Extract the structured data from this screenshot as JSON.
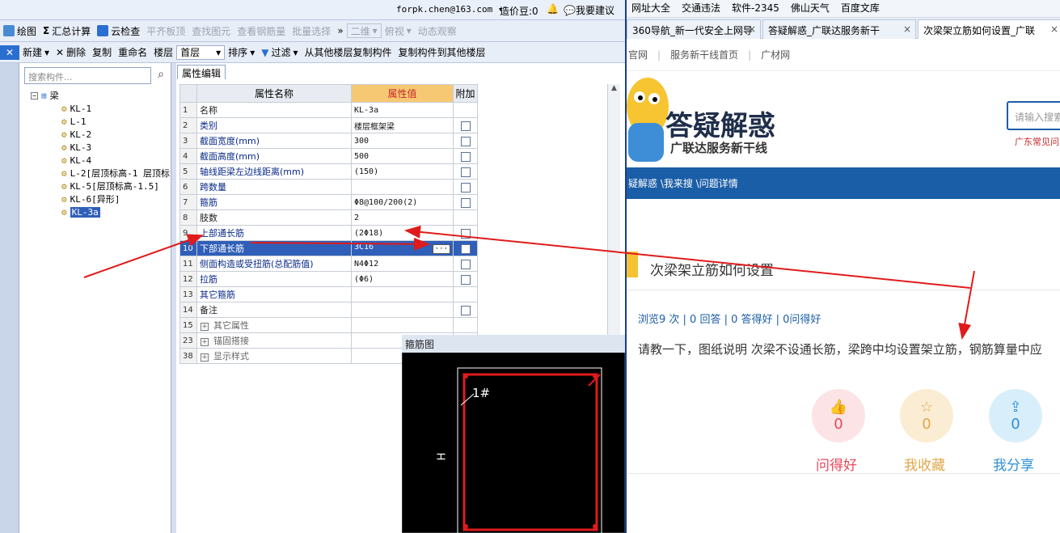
{
  "topbar": {
    "account": "forpk.chen@163.com ▾",
    "price_label": "造价豆:0",
    "suggest": "我要建议"
  },
  "toolbar1": {
    "draw": "绘图",
    "sum": "汇总计算",
    "cloud": "云检查",
    "level": "平齐板顶",
    "find": "查找图元",
    "view_rebar": "查看钢筋量",
    "batch": "批量选择",
    "view2d": "二维",
    "top_view": "俯视",
    "dynamic": "动态观察"
  },
  "toolbar2": {
    "new": "新建",
    "delete": "删除",
    "copy": "复制",
    "rename": "重命名",
    "floor_label": "楼层",
    "floor_value": "首层",
    "sort": "排序",
    "filter": "过滤",
    "copy_from": "从其他楼层复制构件",
    "copy_to": "复制构件到其他楼层"
  },
  "tree": {
    "search_placeholder": "搜索构件...",
    "root": "梁",
    "items": [
      "KL-1",
      "L-1",
      "KL-2",
      "KL-3",
      "KL-4",
      "L-2[层顶标高-1 层顶标",
      "KL-5[层顶标高-1.5]",
      "KL-6[异形]",
      "KL-3a"
    ]
  },
  "props": {
    "tab": "属性编辑",
    "headers": {
      "name": "属性名称",
      "value": "属性值",
      "extra": "附加"
    },
    "rows": [
      {
        "n": "1",
        "name": "名称",
        "value": "KL-3a",
        "check": false
      },
      {
        "n": "2",
        "name": "类别",
        "value": "楼层框架梁",
        "check": true
      },
      {
        "n": "3",
        "name": "截面宽度(mm)",
        "value": "300",
        "check": true
      },
      {
        "n": "4",
        "name": "截面高度(mm)",
        "value": "500",
        "check": true
      },
      {
        "n": "5",
        "name": "轴线距梁左边线距离(mm)",
        "value": "(150)",
        "check": true
      },
      {
        "n": "6",
        "name": "跨数量",
        "value": "",
        "check": true
      },
      {
        "n": "7",
        "name": "箍筋",
        "value": "Φ8@100/200(2)",
        "check": true
      },
      {
        "n": "8",
        "name": "肢数",
        "value": "2",
        "check": false
      },
      {
        "n": "9",
        "name": "上部通长筋",
        "value": "(2Φ18)",
        "check": true
      },
      {
        "n": "10",
        "name": "下部通长筋",
        "value": "3C16",
        "check": true
      },
      {
        "n": "11",
        "name": "侧面构造或受扭筋(总配筋值)",
        "value": "N4Φ12",
        "check": true
      },
      {
        "n": "12",
        "name": "拉筋",
        "value": "(Φ6)",
        "check": true
      },
      {
        "n": "13",
        "name": "其它箍筋",
        "value": "",
        "check": false
      },
      {
        "n": "14",
        "name": "备注",
        "value": "",
        "check": true
      },
      {
        "n": "15",
        "name": "其它属性",
        "value": "",
        "check": false
      },
      {
        "n": "23",
        "name": "锚固搭接",
        "value": "",
        "check": false
      },
      {
        "n": "38",
        "name": "显示样式",
        "value": "",
        "check": false
      }
    ]
  },
  "stirrup": {
    "title": "箍筋图",
    "label_1": "1#",
    "label_h": "H"
  },
  "browser": {
    "bookmarks": [
      "网址大全",
      "交通违法",
      "软件-2345",
      "佛山天气",
      "百度文库"
    ],
    "tabs": [
      "360导航_新一代安全上网导",
      "答疑解惑_广联达服务新干",
      "次梁架立筋如何设置_广联"
    ],
    "nav": [
      "官网",
      "服务新干线首页",
      "广材网"
    ],
    "brand": "答疑解惑",
    "brand_sub": "广联达服务新干线",
    "search_placeholder": "请输入搜索",
    "region": "广东常见问",
    "breadcrumb": "疑解惑 \\我来搜 \\问题详情",
    "question_title": "次梁架立筋如何设置",
    "stats": "浏览9 次 | 0 回答 | 0 答得好 | 0问得好",
    "question_body": "请教一下，图纸说明 次梁不设通长筋，梁跨中均设置架立筋，钢筋算量中应",
    "actions": [
      {
        "count": "0",
        "label": "问得好"
      },
      {
        "count": "0",
        "label": "我收藏"
      },
      {
        "count": "0",
        "label": "我分享"
      }
    ]
  },
  "colors": {
    "accent": "#1b5ea8",
    "arrow": "#e01b1b",
    "good": "#e64a5e",
    "fav": "#e1a84a",
    "share": "#2f8fd6"
  }
}
